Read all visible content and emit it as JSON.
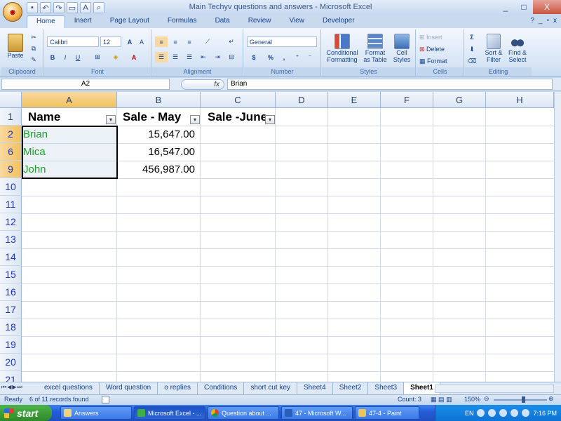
{
  "window": {
    "title": "Main Techyv questions and answers - Microsoft Excel",
    "office_button_label": "Office",
    "controls": [
      "_",
      "□",
      "X"
    ]
  },
  "ribbon": {
    "tabs": [
      "Home",
      "Insert",
      "Page Layout",
      "Formulas",
      "Data",
      "Review",
      "View",
      "Developer"
    ],
    "active_tab": "Home",
    "groups": {
      "clipboard": {
        "label": "Clipboard",
        "paste": "Paste"
      },
      "font": {
        "label": "Font",
        "font_name": "Calibri",
        "font_size": "12"
      },
      "alignment": {
        "label": "Alignment"
      },
      "number": {
        "label": "Number",
        "format": "General"
      },
      "styles": {
        "label": "Styles",
        "conditional": "Conditional Formatting",
        "format_table": "Format as Table",
        "cell_styles": "Cell Styles"
      },
      "cells": {
        "label": "Cells",
        "insert": "Insert",
        "delete": "Delete",
        "format": "Format"
      },
      "editing": {
        "label": "Editing",
        "sort": "Sort & Filter",
        "find": "Find & Select"
      }
    }
  },
  "formula_bar": {
    "name_box": "A2",
    "fx": "fx",
    "content": "Brian"
  },
  "sheet": {
    "columns": [
      "A",
      "B",
      "C",
      "D",
      "E",
      "F",
      "G",
      "H"
    ],
    "rows": [
      "1",
      "2",
      "6",
      "9",
      "10",
      "11",
      "12",
      "13",
      "14",
      "15",
      "16",
      "17",
      "18",
      "19",
      "20",
      "21"
    ],
    "headers": [
      "Name",
      "Sale - May",
      "Sale -June"
    ],
    "data": [
      {
        "name": "Brian",
        "may": "15,647.00"
      },
      {
        "name": "Mica",
        "may": "16,547.00"
      },
      {
        "name": "John",
        "may": "456,987.00"
      }
    ]
  },
  "sheet_tabs": [
    "excel questions",
    "Word question",
    "o replies",
    "Conditions",
    "short cut key",
    "Sheet4",
    "Sheet2",
    "Sheet3",
    "Sheet1"
  ],
  "active_sheet": "Sheet1",
  "status": {
    "ready": "Ready",
    "records": "6 of 11 records found",
    "count": "Count: 3",
    "zoom": "150%"
  },
  "taskbar": {
    "start": "start",
    "tasks": [
      "Answers",
      "Microsoft Excel - ...",
      "Question about ...",
      "47 - Microsoft W...",
      "47-4 - Paint"
    ],
    "lang": "EN",
    "time": "7:16 PM"
  }
}
